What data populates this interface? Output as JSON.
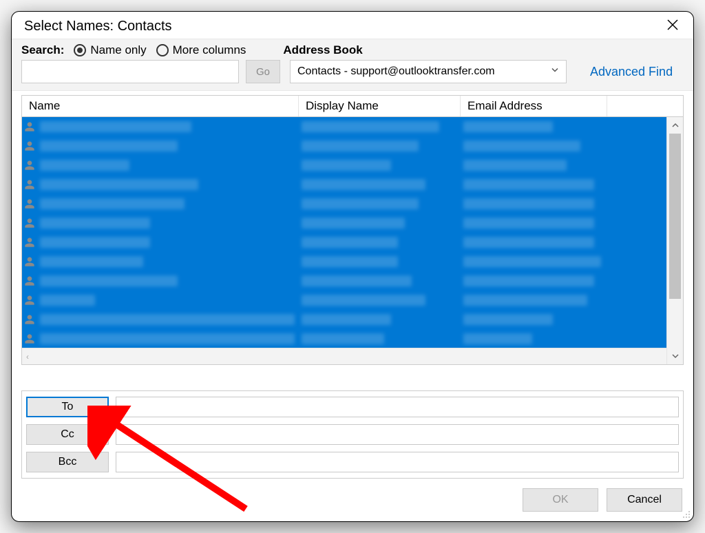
{
  "dialog": {
    "title": "Select Names: Contacts"
  },
  "search": {
    "label": "Search:",
    "radio_name_only": "Name only",
    "radio_more_columns": "More columns",
    "go_label": "Go",
    "value": ""
  },
  "address_book": {
    "label": "Address Book",
    "selected": "Contacts - support@outlooktransfer.com",
    "advanced_find": "Advanced Find"
  },
  "columns": {
    "name": "Name",
    "display_name": "Display Name",
    "email": "Email Address"
  },
  "contacts": [
    {
      "w1": 220,
      "w2": 200,
      "w3": 130
    },
    {
      "w1": 200,
      "w2": 170,
      "w3": 170
    },
    {
      "w1": 130,
      "w2": 130,
      "w3": 150
    },
    {
      "w1": 230,
      "w2": 180,
      "w3": 190
    },
    {
      "w1": 210,
      "w2": 170,
      "w3": 190
    },
    {
      "w1": 160,
      "w2": 150,
      "w3": 190
    },
    {
      "w1": 160,
      "w2": 140,
      "w3": 190
    },
    {
      "w1": 150,
      "w2": 140,
      "w3": 200
    },
    {
      "w1": 200,
      "w2": 160,
      "w3": 190
    },
    {
      "w1": 80,
      "w2": 180,
      "w3": 180
    },
    {
      "w1": 370,
      "w2": 130,
      "w3": 130
    },
    {
      "w1": 370,
      "w2": 120,
      "w3": 100
    },
    {
      "w1": 370,
      "w2": 170,
      "w3": 170
    }
  ],
  "recipients": {
    "to_label": "To",
    "cc_label": "Cc",
    "bcc_label": "Bcc",
    "to_value": "",
    "cc_value": "",
    "bcc_value": ""
  },
  "footer": {
    "ok": "OK",
    "cancel": "Cancel"
  }
}
